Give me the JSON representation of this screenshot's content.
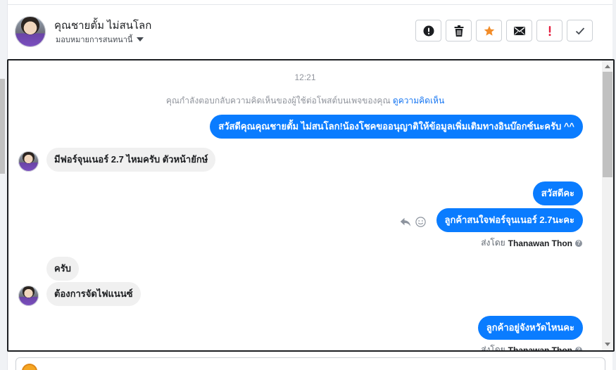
{
  "contact": {
    "name": "คุณชายตั้ม ไม่สนโลก",
    "assign_label": "มอบหมายการสนทนานี้"
  },
  "actions": [
    {
      "name": "report-spam",
      "icon": "exclamation-circle-icon"
    },
    {
      "name": "delete",
      "icon": "trash-icon"
    },
    {
      "name": "star",
      "icon": "star-icon",
      "color": "#f28c28"
    },
    {
      "name": "mark-unread",
      "icon": "envelope-icon"
    },
    {
      "name": "important",
      "icon": "exclamation-icon",
      "color": "#e41e3f"
    },
    {
      "name": "mark-done",
      "icon": "check-icon"
    }
  ],
  "thread": {
    "timestamp": "12:21",
    "notice_text": "คุณกำลังตอบกลับความคิดเห็นของผู้ใช้ต่อโพสต์บนเพจของคุณ",
    "notice_link": "ดูความคิดเห็น",
    "messages": [
      {
        "dir": "out",
        "text": "สวัสดีคุณคุณชายตั้ม ไม่สนโลก!น้องโชคขออนุญาติให้ข้อมูลเพิ่มเติมทางอินบ๊อกซ์นะครับ ^^"
      },
      {
        "dir": "in",
        "text": "มีฟอร์จุนเนอร์ 2.7 ไหมครับ ตัวหน้ายักษ์"
      },
      {
        "dir": "out",
        "text": "สวัสดีคะ"
      },
      {
        "dir": "out",
        "text": "ลูกค้าสนใจฟอร์จุนเนอร์ 2.7นะคะ"
      },
      {
        "dir": "in",
        "text": "ครับ"
      },
      {
        "dir": "in",
        "text": "ต้องการจัดไฟแนนซ์"
      },
      {
        "dir": "out",
        "text": "ลูกค้าอยู่จังหวัดไหนคะ"
      }
    ],
    "sent_by_prefix": "ส่งโดย",
    "sent_by_name": "Thanawan Thon"
  },
  "colors": {
    "outgoing_bubble": "#0a7cff",
    "incoming_bubble": "#f0f0f0",
    "link": "#1877f2"
  }
}
